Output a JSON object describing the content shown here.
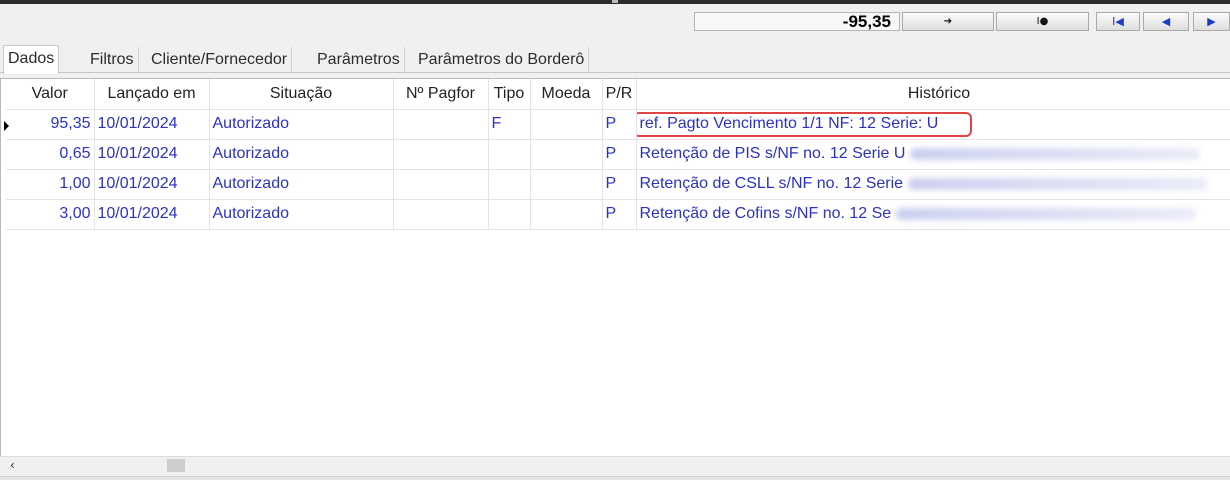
{
  "toolbar": {
    "total": "-95,35",
    "buttons": [
      {
        "name": "next-arrow-button",
        "glyph": "➔"
      },
      {
        "name": "record-button",
        "glyph": "I●"
      },
      {
        "name": "first-record-button",
        "glyph": "I◀"
      },
      {
        "name": "prev-record-button",
        "glyph": "◀"
      },
      {
        "name": "next-record-button",
        "glyph": "▶"
      }
    ]
  },
  "tabs": [
    "Dados",
    "Filtros",
    "Cliente/Fornecedor",
    "Parâmetros",
    "Parâmetros do Borderô"
  ],
  "grid": {
    "columns": [
      "Valor",
      "Lançado em",
      "Situação",
      "Nº Pagfor",
      "Tipo",
      "Moeda",
      "P/R",
      "Histórico"
    ],
    "rows": [
      {
        "valor": "95,35",
        "lancado": "10/01/2024",
        "situacao": "Autorizado",
        "pagfor": "",
        "tipo": "F",
        "moeda": "",
        "pr": "P",
        "historico": "ref. Pagto Vencimento 1/1 NF: 12 Serie: U"
      },
      {
        "valor": "0,65",
        "lancado": "10/01/2024",
        "situacao": "Autorizado",
        "pagfor": "",
        "tipo": "",
        "moeda": "",
        "pr": "P",
        "historico": "Retenção de PIS s/NF no. 12 Serie U"
      },
      {
        "valor": "1,00",
        "lancado": "10/01/2024",
        "situacao": "Autorizado",
        "pagfor": "",
        "tipo": "",
        "moeda": "",
        "pr": "P",
        "historico": "Retenção de CSLL s/NF no. 12 Serie"
      },
      {
        "valor": "3,00",
        "lancado": "10/01/2024",
        "situacao": "Autorizado",
        "pagfor": "",
        "tipo": "",
        "moeda": "",
        "pr": "P",
        "historico": "Retenção de Cofins s/NF no. 12 Se"
      }
    ]
  },
  "colors": {
    "cell_text": "#2b32c4",
    "highlight": "#e04545"
  }
}
